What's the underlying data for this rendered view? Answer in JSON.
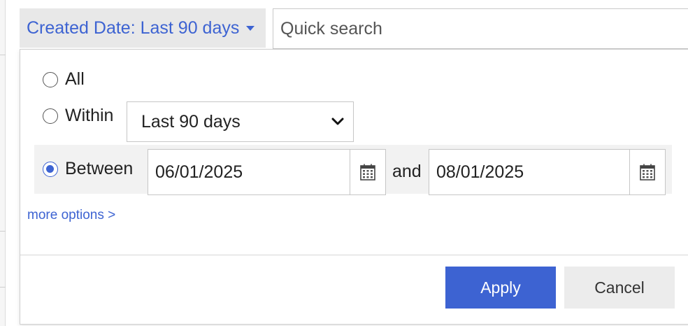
{
  "filter_chip": {
    "label": "Created Date: Last 90 days",
    "icon": "caret-down-icon"
  },
  "search": {
    "placeholder": "Quick search",
    "value": ""
  },
  "date_filter": {
    "options": [
      {
        "key": "all",
        "label": "All",
        "selected": false
      },
      {
        "key": "within",
        "label": "Within",
        "selected": false
      },
      {
        "key": "between",
        "label": "Between",
        "selected": true
      }
    ],
    "within_select": {
      "value": "Last 90 days",
      "icon": "chevron-down-icon"
    },
    "between": {
      "start_date": "06/01/2025",
      "and_label": "and",
      "end_date": "08/01/2025",
      "icon": "calendar-icon"
    },
    "more_options_label": "more options >"
  },
  "actions": {
    "apply_label": "Apply",
    "cancel_label": "Cancel"
  },
  "colors": {
    "accent": "#3d63d2",
    "chip_bg": "#e8e8e8",
    "band_bg": "#f2f2f2",
    "cancel_bg": "#ececec"
  }
}
